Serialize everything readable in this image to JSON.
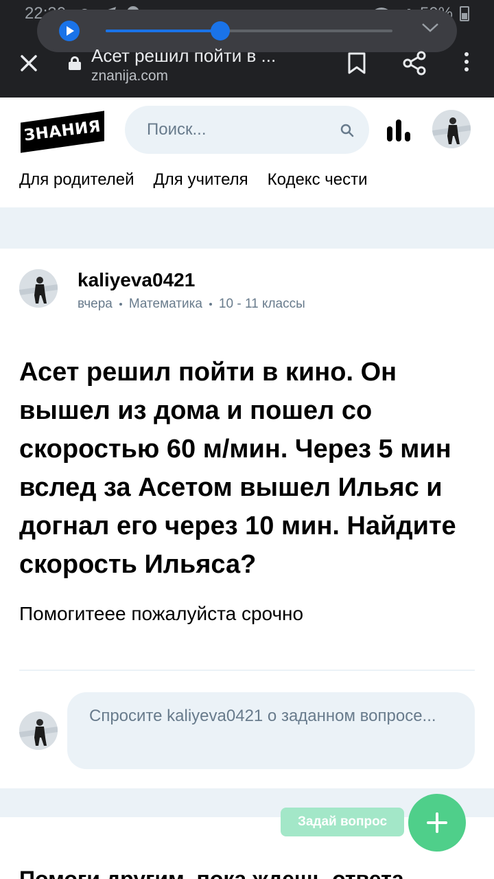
{
  "status_bar": {
    "time": "22:30",
    "battery": "50%"
  },
  "media_player": {
    "progress": 0.4
  },
  "browser": {
    "page_title": "Асет решил пойти в ...",
    "url": "znanija.com"
  },
  "site": {
    "logo_text": "ЗНАНИЯ",
    "search_placeholder": "Поиск...",
    "nav": [
      "Для родителей",
      "Для учителя",
      "Кодекс чести"
    ]
  },
  "question": {
    "author": "kaliyeva0421",
    "time": "вчера",
    "subject": "Математика",
    "grade": "10 - 11 классы",
    "text": "Асет решил пойти в кино. Он вышел из дома и пошел со скоростью 60 м/мин. Через 5 мин вслед за Асетом вышел Ильяс и догнал его через 10 мин. Найдите скорость Ильяса?",
    "extra": "Помогитеее пожалуйста срочно",
    "comment_placeholder": "Спросите kaliyeva0421 о заданном вопросе..."
  },
  "bottom": {
    "help_title": "Помоги другим, пока ждешь ответа",
    "ask_button": "Задай вопрос"
  },
  "colors": {
    "chrome_bg": "#202124",
    "accent_blue": "#1a73e8",
    "band_gray": "#ebf2f7",
    "muted_text": "#687b8c",
    "fab_green": "#4fcf8a"
  }
}
